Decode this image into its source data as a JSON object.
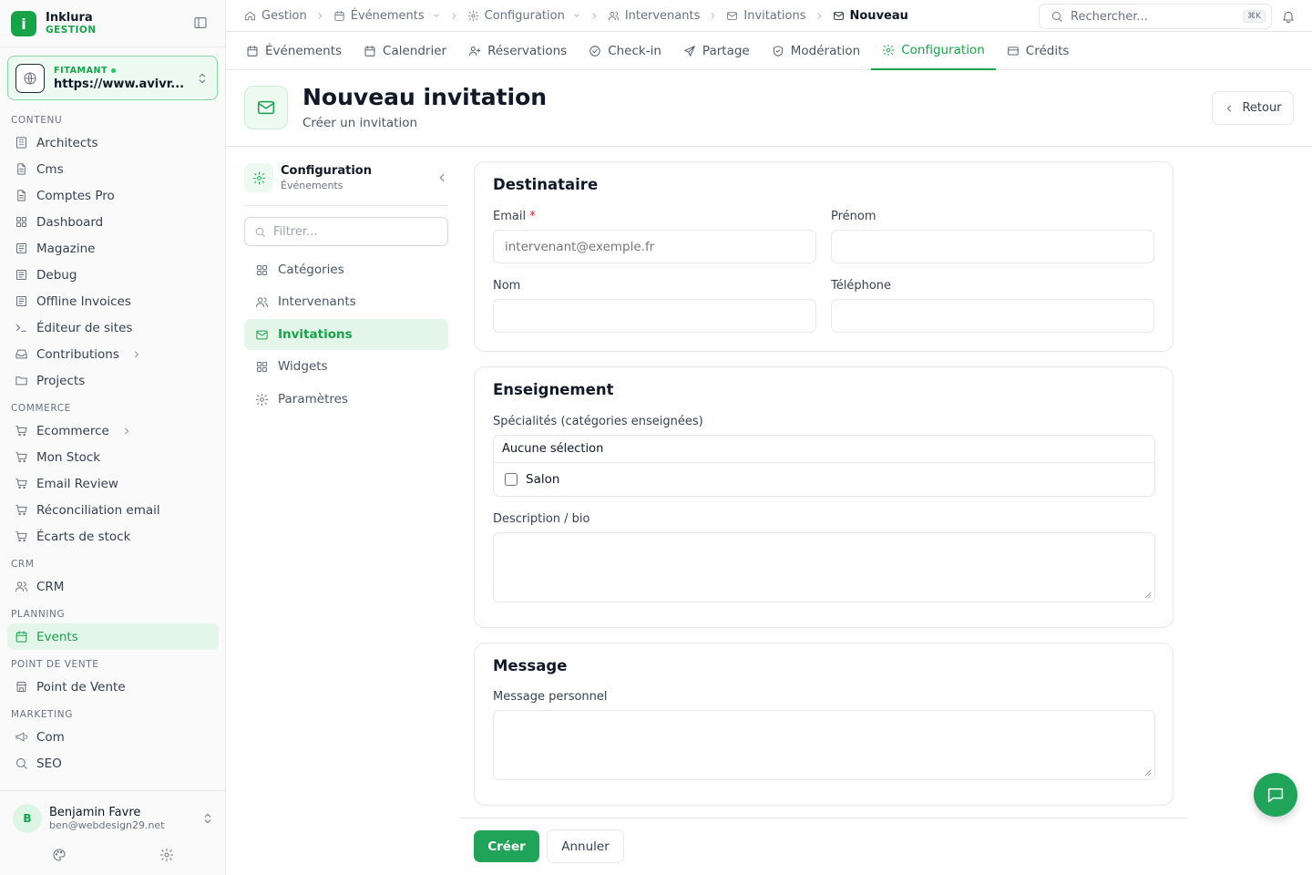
{
  "brand": {
    "name": "Inklura",
    "sub": "GESTION"
  },
  "site": {
    "label": "FITAMANT",
    "url": "https://www.avivr..."
  },
  "sidebar": {
    "sections": [
      {
        "title": "CONTENU",
        "items": [
          {
            "label": "Architects",
            "icon": "building-icon"
          },
          {
            "label": "Cms",
            "icon": "file-icon"
          },
          {
            "label": "Comptes Pro",
            "icon": "file-icon"
          },
          {
            "label": "Dashboard",
            "icon": "grid-icon"
          },
          {
            "label": "Magazine",
            "icon": "newspaper-icon"
          },
          {
            "label": "Debug",
            "icon": "newspaper-icon"
          },
          {
            "label": "Offline Invoices",
            "icon": "newspaper-icon"
          },
          {
            "label": "Éditeur de sites",
            "icon": "terminal-icon"
          },
          {
            "label": "Contributions",
            "icon": "inbox-icon",
            "chevron": true
          },
          {
            "label": "Projects",
            "icon": "folder-icon"
          }
        ]
      },
      {
        "title": "COMMERCE",
        "items": [
          {
            "label": "Ecommerce",
            "icon": "cart-icon",
            "chevron": true
          },
          {
            "label": "Mon Stock",
            "icon": "cart-icon"
          },
          {
            "label": "Email Review",
            "icon": "cart-icon"
          },
          {
            "label": "Réconciliation email",
            "icon": "cart-icon"
          },
          {
            "label": "Écarts de stock",
            "icon": "cart-icon"
          }
        ]
      },
      {
        "title": "CRM",
        "items": [
          {
            "label": "CRM",
            "icon": "users-icon"
          }
        ]
      },
      {
        "title": "PLANNING",
        "items": [
          {
            "label": "Events",
            "icon": "calendar-icon",
            "active": true
          }
        ]
      },
      {
        "title": "POINT DE VENTE",
        "items": [
          {
            "label": "Point de Vente",
            "icon": "store-icon"
          }
        ]
      },
      {
        "title": "MARKETING",
        "items": [
          {
            "label": "Com",
            "icon": "megaphone-icon"
          },
          {
            "label": "SEO",
            "icon": "search-icon"
          }
        ]
      }
    ]
  },
  "user": {
    "initial": "B",
    "name": "Benjamin Favre",
    "email": "ben@webdesign29.net"
  },
  "breadcrumb": {
    "items": [
      {
        "label": "Gestion",
        "icon": "home-icon"
      },
      {
        "label": "Événements",
        "icon": "calendar-icon",
        "dropdown": true
      },
      {
        "label": "Configuration",
        "icon": "gear-icon",
        "dropdown": true
      },
      {
        "label": "Intervenants",
        "icon": "users-icon"
      },
      {
        "label": "Invitations",
        "icon": "mail-icon"
      },
      {
        "label": "Nouveau",
        "icon": "mail-icon",
        "current": true
      }
    ]
  },
  "search": {
    "placeholder": "Rechercher...",
    "shortcut": "⌘K"
  },
  "tabs": [
    {
      "label": "Événements",
      "icon": "calendar-icon"
    },
    {
      "label": "Calendrier",
      "icon": "calendar-icon"
    },
    {
      "label": "Réservations",
      "icon": "user-plus-icon"
    },
    {
      "label": "Check-in",
      "icon": "check-circle-icon"
    },
    {
      "label": "Partage",
      "icon": "send-icon"
    },
    {
      "label": "Modération",
      "icon": "shield-icon"
    },
    {
      "label": "Configuration",
      "icon": "gear-icon",
      "active": true
    },
    {
      "label": "Crédits",
      "icon": "card-icon"
    }
  ],
  "page": {
    "title": "Nouveau invitation",
    "subtitle": "Créer un invitation",
    "back_label": "Retour"
  },
  "config_nav": {
    "title": "Configuration",
    "subtitle": "Événements",
    "filter_placeholder": "Filtrer...",
    "items": [
      {
        "label": "Catégories",
        "icon": "grid-icon"
      },
      {
        "label": "Intervenants",
        "icon": "users-icon"
      },
      {
        "label": "Invitations",
        "icon": "mail-icon",
        "active": true
      },
      {
        "label": "Widgets",
        "icon": "grid-icon"
      },
      {
        "label": "Paramètres",
        "icon": "gear-icon"
      }
    ]
  },
  "form": {
    "recipient": {
      "title": "Destinataire",
      "email_label": "Email",
      "email_required": "*",
      "email_placeholder": "intervenant@exemple.fr",
      "email_value": "",
      "firstname_label": "Prénom",
      "firstname_value": "",
      "lastname_label": "Nom",
      "lastname_value": "",
      "phone_label": "Téléphone",
      "phone_value": ""
    },
    "teaching": {
      "title": "Enseignement",
      "specialties_label": "Spécialités (catégories enseignées)",
      "selection_text": "Aucune sélection",
      "options": [
        {
          "label": "Salon",
          "checked": false
        }
      ],
      "bio_label": "Description / bio",
      "bio_value": ""
    },
    "message": {
      "title": "Message",
      "personal_label": "Message personnel",
      "personal_value": ""
    },
    "create_label": "Créer",
    "cancel_label": "Annuler"
  },
  "colors": {
    "accent": "#16a34a",
    "accent_soft": "#e4f5ea",
    "required": "#dc2626"
  }
}
